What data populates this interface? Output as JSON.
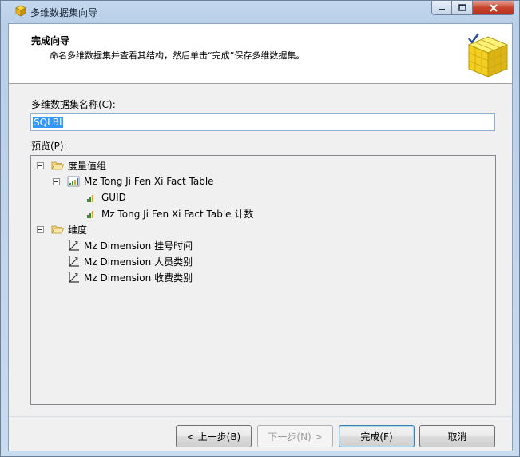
{
  "window": {
    "title": "多维数据集向导"
  },
  "header": {
    "title": "完成向导",
    "description": "命名多维数据集并查看其结构，然后单击“完成”保存多维数据集。"
  },
  "form": {
    "name_label": "多维数据集名称(C):",
    "name_value": "SQLBI",
    "preview_label": "预览(P):"
  },
  "tree": {
    "measure_groups": "度量值组",
    "fact_table": "Mz Tong Ji Fen Xi Fact Table",
    "measure_guid": "GUID",
    "measure_count": "Mz Tong Ji Fen Xi Fact Table 计数",
    "dimensions": "维度",
    "dim_1": "Mz Dimension 挂号时间",
    "dim_2": "Mz Dimension 人员类别",
    "dim_3": "Mz Dimension 收费类别"
  },
  "buttons": {
    "back": "< 上一步(B)",
    "next": "下一步(N) >",
    "finish": "完成(F)",
    "cancel": "取消"
  },
  "colors": {
    "selection": "#3399ff",
    "input_border": "#8db2d6",
    "close_button": "#c7452f"
  }
}
